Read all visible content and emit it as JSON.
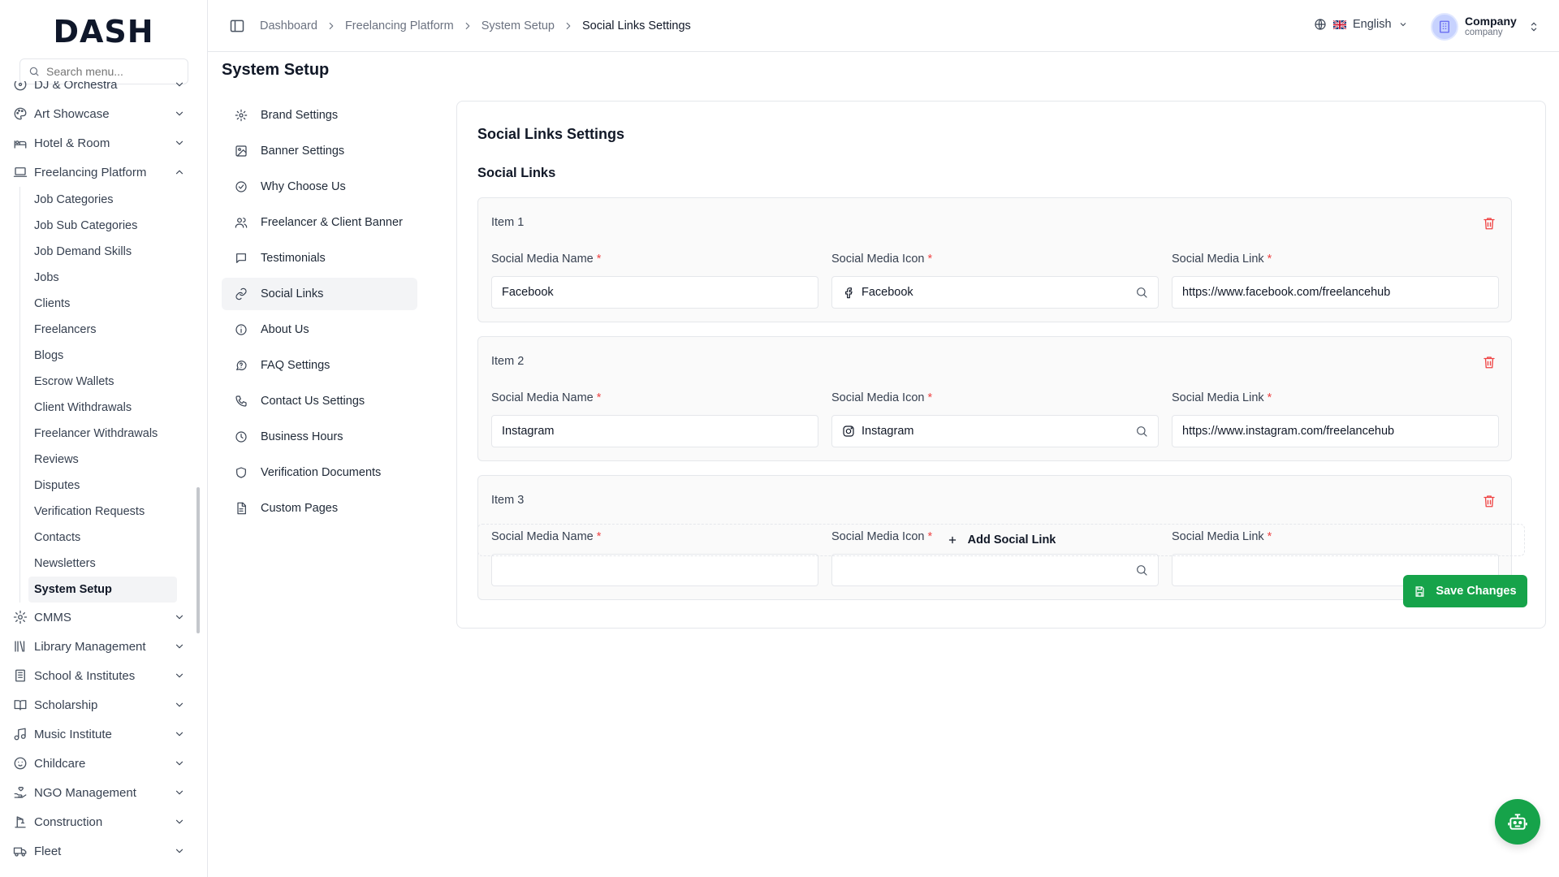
{
  "brand": {
    "logo": "DASH"
  },
  "sidebar": {
    "search_placeholder": "Search menu...",
    "groups_top": [
      {
        "label": "DJ & Orchestra",
        "icon": "music-disc-icon"
      },
      {
        "label": "Art Showcase",
        "icon": "palette-icon"
      },
      {
        "label": "Hotel & Room",
        "icon": "hotel-icon"
      },
      {
        "label": "Freelancing Platform",
        "icon": "laptop-icon"
      }
    ],
    "subitems": [
      "Job Categories",
      "Job Sub Categories",
      "Job Demand Skills",
      "Jobs",
      "Clients",
      "Freelancers",
      "Blogs",
      "Escrow Wallets",
      "Client Withdrawals",
      "Freelancer Withdrawals",
      "Reviews",
      "Disputes",
      "Verification Requests",
      "Contacts",
      "Newsletters",
      "System Setup"
    ],
    "active_subitem": "System Setup",
    "groups_bottom": [
      {
        "label": "CMMS",
        "icon": "gear-icon"
      },
      {
        "label": "Library Management",
        "icon": "library-icon"
      },
      {
        "label": "School & Institutes",
        "icon": "school-icon"
      },
      {
        "label": "Scholarship",
        "icon": "book-open-icon"
      },
      {
        "label": "Music Institute",
        "icon": "music-note-icon"
      },
      {
        "label": "Childcare",
        "icon": "baby-icon"
      },
      {
        "label": "NGO Management",
        "icon": "hand-heart-icon"
      },
      {
        "label": "Construction",
        "icon": "crane-icon"
      },
      {
        "label": "Fleet",
        "icon": "truck-icon"
      }
    ]
  },
  "header": {
    "breadcrumb": [
      "Dashboard",
      "Freelancing Platform",
      "System Setup",
      "Social Links Settings"
    ],
    "language": "English",
    "user": {
      "name": "Company",
      "role": "company"
    }
  },
  "page": {
    "title": "System Setup",
    "setup_menu": [
      {
        "label": "Brand Settings",
        "icon": "gear-icon"
      },
      {
        "label": "Banner Settings",
        "icon": "image-icon"
      },
      {
        "label": "Why Choose Us",
        "icon": "check-circle-icon"
      },
      {
        "label": "Freelancer & Client Banner",
        "icon": "users-icon"
      },
      {
        "label": "Testimonials",
        "icon": "message-square-icon"
      },
      {
        "label": "Social Links",
        "icon": "link-icon"
      },
      {
        "label": "About Us",
        "icon": "info-icon"
      },
      {
        "label": "FAQ Settings",
        "icon": "help-message-icon"
      },
      {
        "label": "Contact Us Settings",
        "icon": "phone-icon"
      },
      {
        "label": "Business Hours",
        "icon": "clock-icon"
      },
      {
        "label": "Verification Documents",
        "icon": "shield-icon"
      },
      {
        "label": "Custom Pages",
        "icon": "file-text-icon"
      }
    ],
    "active_menu": "Social Links"
  },
  "social_links": {
    "card_title": "Social Links Settings",
    "section_title": "Social Links",
    "field_labels": {
      "name": "Social Media Name",
      "icon": "Social Media Icon",
      "link": "Social Media Link"
    },
    "required_mark": "*",
    "items": [
      {
        "label": "Item 1",
        "name": "Facebook",
        "icon_value": "Facebook",
        "icon": "facebook-icon",
        "link": "https://www.facebook.com/freelancehub"
      },
      {
        "label": "Item 2",
        "name": "Instagram",
        "icon_value": "Instagram",
        "icon": "instagram-icon",
        "link": "https://www.instagram.com/freelancehub"
      },
      {
        "label": "Item 3",
        "name": "",
        "icon_value": "",
        "icon": "",
        "link": ""
      }
    ],
    "add_button": "Add Social Link",
    "save_button": "Save Changes"
  },
  "colors": {
    "primary": "#16a34a",
    "danger": "#ef4444",
    "border": "#e5e7eb"
  }
}
